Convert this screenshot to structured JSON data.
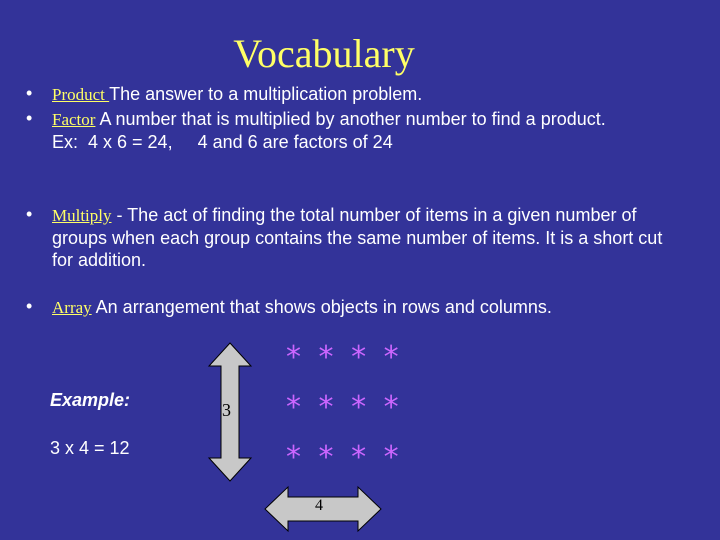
{
  "title": "Vocabulary",
  "bullet_glyph": "•",
  "items": [
    {
      "term": "Product ",
      "text": "The answer to a multiplication problem."
    },
    {
      "term": "Factor",
      "text": " A number that is multiplied by another number to find a product.",
      "line2": "Ex:  4 x 6 = 24,     4 and 6 are factors of 24"
    },
    {
      "term": "Multiply",
      "text": " - The act of finding the total number of items in a given number of groups when each group contains the same number of items. It is a short cut for addition."
    },
    {
      "term": "Array",
      "text": " An arrangement that shows objects in rows and columns."
    }
  ],
  "example": {
    "label": "Example:",
    "equation": "3 x 4 = 12",
    "rows_label": "3",
    "cols_label": "4",
    "stars": [
      "* * * *",
      "* * * *",
      "* * * *"
    ]
  },
  "colors": {
    "background": "#333399",
    "title": "#ffff66",
    "star": "#cc66ff",
    "arrow": "#c8c8c8"
  }
}
